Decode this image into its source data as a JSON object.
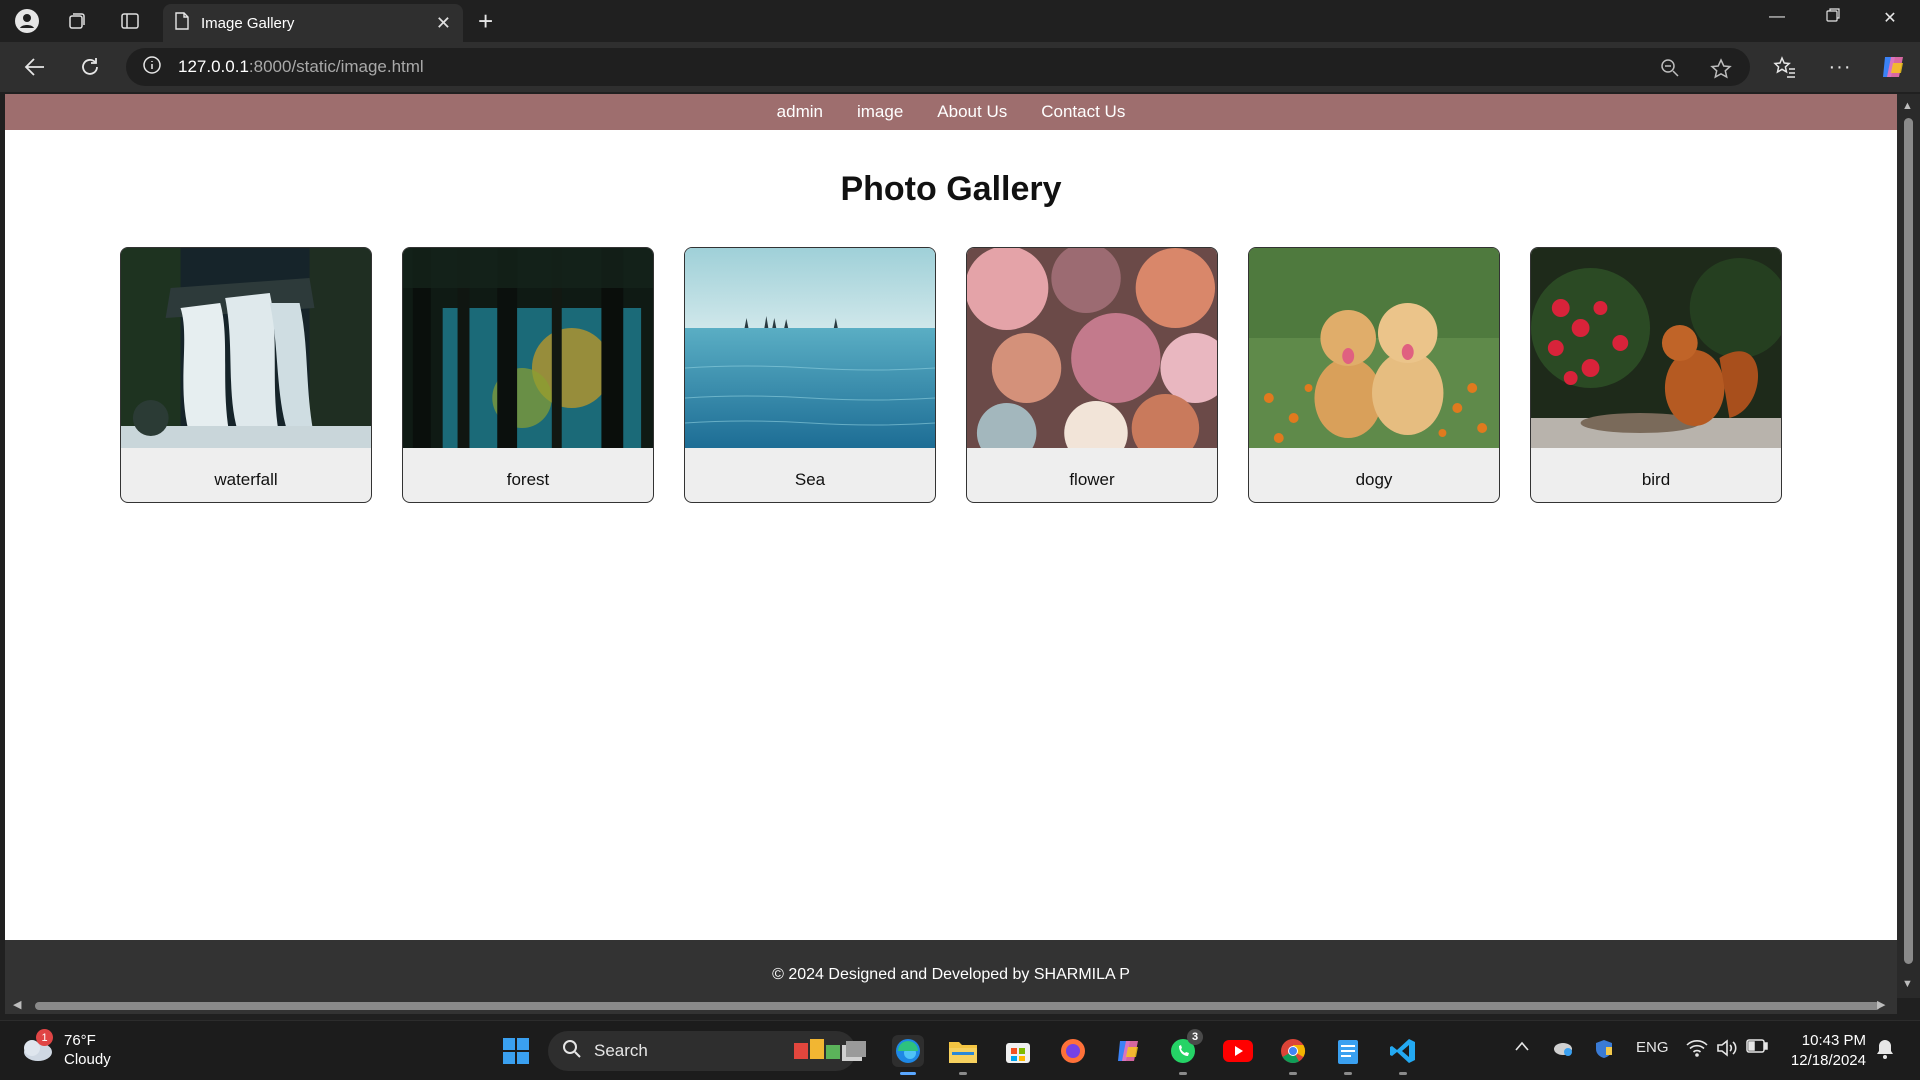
{
  "browser": {
    "tab_title": "Image Gallery",
    "url_host": "127.0.0.1",
    "url_path": ":8000/static/image.html"
  },
  "site": {
    "nav": [
      {
        "label": "admin"
      },
      {
        "label": "image"
      },
      {
        "label": "About Us"
      },
      {
        "label": "Contact Us"
      }
    ],
    "title": "Photo Gallery",
    "gallery": [
      {
        "caption": "waterfall"
      },
      {
        "caption": "forest"
      },
      {
        "caption": "Sea"
      },
      {
        "caption": "flower"
      },
      {
        "caption": "dogy"
      },
      {
        "caption": "bird"
      }
    ],
    "footer": "© 2024 Designed and Developed by SHARMILA P"
  },
  "taskbar": {
    "weather_temp": "76°F",
    "weather_desc": "Cloudy",
    "weather_badge": "1",
    "search_label": "Search",
    "whatsapp_badge": "3",
    "lang": "ENG",
    "time": "10:43 PM",
    "date": "12/18/2024"
  }
}
